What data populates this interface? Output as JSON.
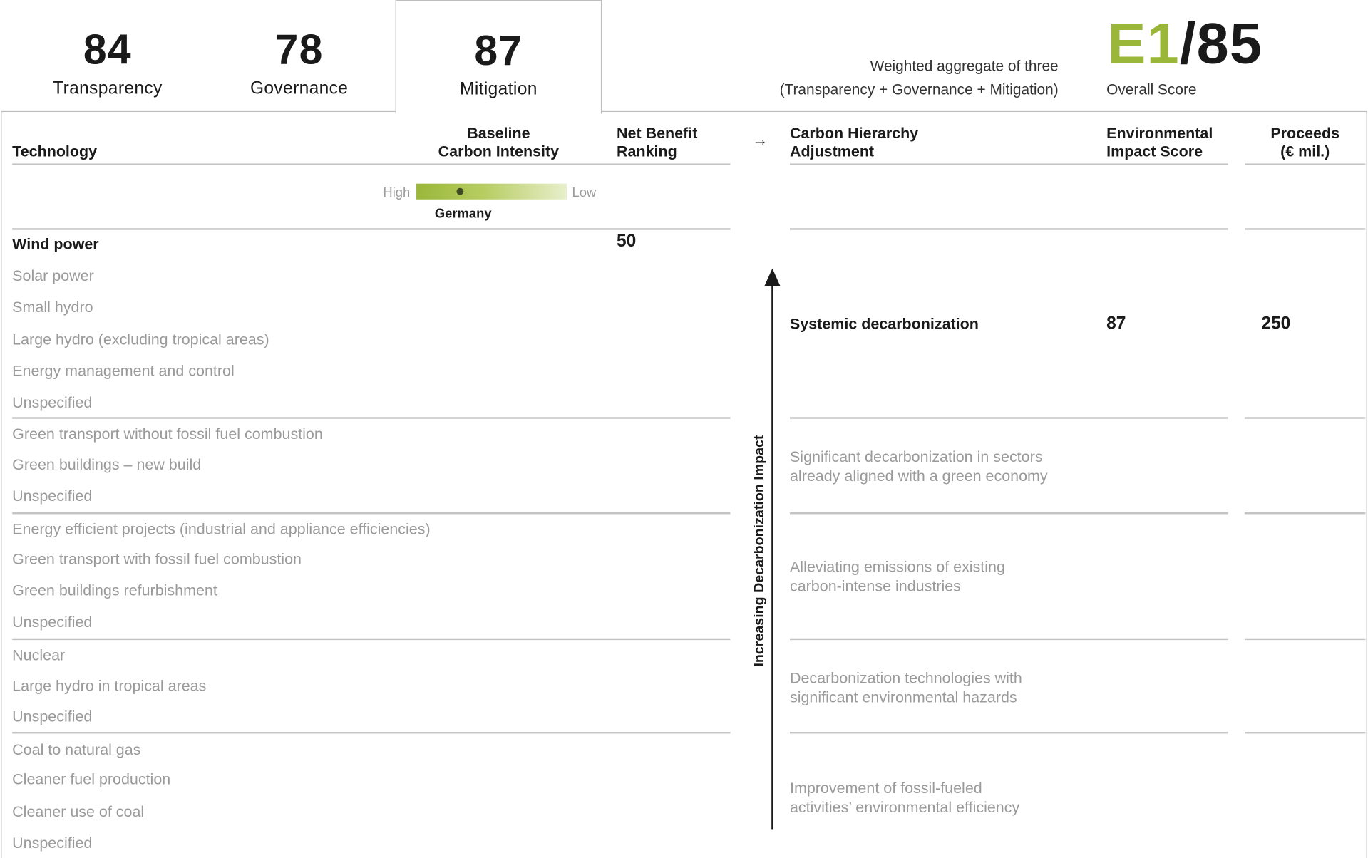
{
  "tabs": [
    {
      "score": "84",
      "label": "Transparency"
    },
    {
      "score": "78",
      "label": "Governance"
    },
    {
      "score": "87",
      "label": "Mitigation"
    }
  ],
  "summary": {
    "weighted_line1": "Weighted aggregate of three",
    "weighted_line2": "(Transparency + Governance + Mitigation)",
    "score_prefix": "E1",
    "score_suffix": "/85",
    "overall_label": "Overall Score"
  },
  "headers": {
    "technology": "Technology",
    "baseline_1": "Baseline",
    "baseline_2": "Carbon Intensity",
    "net_benefit_1": "Net Benefit",
    "net_benefit_2": "Ranking",
    "arrow": "→",
    "hierarchy_1": "Carbon Hierarchy",
    "hierarchy_2": "Adjustment",
    "impact_1": "Environmental",
    "impact_2": "Impact Score",
    "proceeds_1": "Proceeds",
    "proceeds_2": "(€ mil.)"
  },
  "intensity_scale": {
    "high_label": "High",
    "low_label": "Low",
    "country": "Germany",
    "colors": [
      "#9ab73a",
      "#e8efcc"
    ]
  },
  "technologies": [
    "Wind power",
    "Solar power",
    "Small hydro",
    "Large hydro (excluding tropical areas)",
    "Energy management and control",
    "Unspecified",
    "Green transport without fossil fuel combustion",
    "Green buildings – new build",
    "Unspecified",
    "Energy efficient projects (industrial and appliance efficiencies)",
    "Green transport with fossil fuel combustion",
    "Green buildings refurbishment",
    "Unspecified",
    "Nuclear",
    "Large hydro in tropical areas",
    "Unspecified",
    "Coal to natural gas",
    "Cleaner fuel production",
    "Cleaner use of coal",
    "Unspecified"
  ],
  "net_benefit_ranking": "50",
  "hierarchy": [
    {
      "line1": "Systemic decarbonization",
      "line2": ""
    },
    {
      "line1": "Significant decarbonization in sectors",
      "line2": "already aligned with a green economy"
    },
    {
      "line1": "Alleviating emissions of existing",
      "line2": "carbon-intense industries"
    },
    {
      "line1": "Decarbonization technologies with",
      "line2": "significant environmental hazards"
    },
    {
      "line1": "Improvement of fossil-fueled",
      "line2": "activities’ environmental efficiency"
    }
  ],
  "environmental_impact_score": "87",
  "proceeds": "250",
  "axis_label": "Increasing Decarbonization Impact",
  "colors": {
    "accent": "#9ab73a",
    "muted_text": "#9a9a9a",
    "border": "#bdbdbd"
  }
}
